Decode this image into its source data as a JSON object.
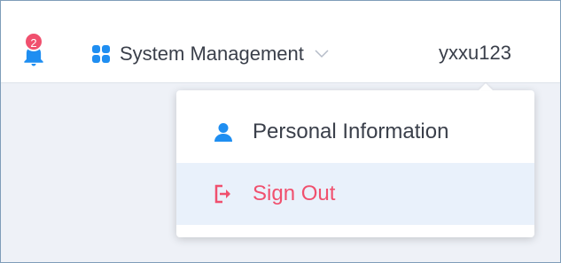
{
  "header": {
    "notifications": {
      "icon": "bell-icon",
      "count": "2",
      "badge_color": "#f0506e",
      "icon_color": "#1f8ef1"
    },
    "system_management": {
      "icon": "grid-icon",
      "label": "System Management",
      "chevron": "chevron-down-icon",
      "icon_color": "#1f8ef1"
    },
    "user": {
      "name": "yxxu123"
    }
  },
  "user_menu": {
    "items": [
      {
        "icon": "user-icon",
        "label": "Personal Information",
        "color": "#3a3f4a",
        "icon_color": "#1f8ef1"
      },
      {
        "icon": "sign-out-icon",
        "label": "Sign Out",
        "color": "#f0506e",
        "highlighted": true
      }
    ]
  }
}
